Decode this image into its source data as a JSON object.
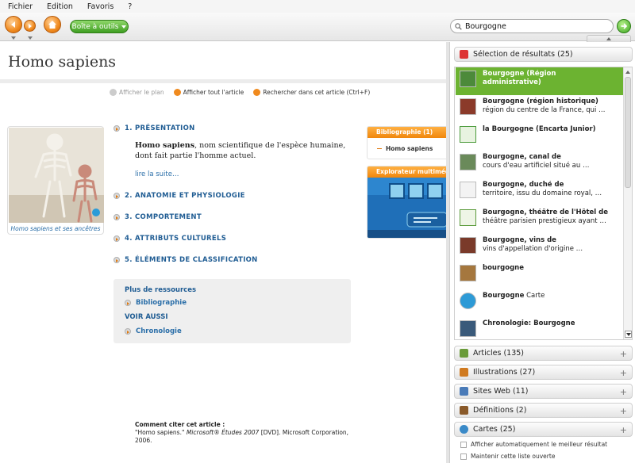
{
  "menu": [
    "Fichier",
    "Edition",
    "Favoris",
    "?"
  ],
  "toolbar": {
    "toolbox_label": "Boîte à outils",
    "search_value": "Bourgogne"
  },
  "article": {
    "title": "Homo sapiens",
    "tools": [
      "Afficher le plan",
      "Afficher tout l'article",
      "Rechercher dans cet article (Ctrl+F)"
    ],
    "image_caption": "Homo sapiens et ses ancêtres",
    "sections": [
      "1. PRÉSENTATION",
      "2. ANATOMIE ET PHYSIOLOGIE",
      "3. COMPORTEMENT",
      "4. ATTRIBUTS CULTURELS",
      "5. ÉLÉMENTS DE CLASSIFICATION"
    ],
    "intro_bold": "Homo sapiens",
    "intro_rest": ", nom scientifique de l'espèce humaine, dont fait partie l'homme actuel.",
    "read_more": "lire la suite…",
    "resources": {
      "title": "Plus de ressources",
      "biblio": "Bibliographie",
      "see_also": "VOIR AUSSI",
      "chrono": "Chronologie"
    },
    "citation": {
      "heading": "Comment citer cet article :",
      "text_a": "\"Homo sapiens.\" ",
      "text_b": "Microsoft® Études 2007",
      "text_c": " [DVD]. Microsoft Corporation, 2006."
    },
    "sidebar": {
      "biblio_title": "Bibliographie",
      "biblio_count": "(1)",
      "biblio_item": "Homo sapiens",
      "explorer_title": "Explorateur multimédia"
    }
  },
  "panel": {
    "results_title": "Sélection de résultats (25)",
    "results": [
      {
        "title": "Bourgogne (Région administrative)",
        "sub": "",
        "icon": "map-thumbnail"
      },
      {
        "title": "Bourgogne (région historique)",
        "sub": "région du centre de la France, qui …",
        "icon": "painting-thumbnail"
      },
      {
        "title": "la Bourgogne (Encarta Junior)",
        "sub": "",
        "icon": "junior-article-icon"
      },
      {
        "title": "Bourgogne, canal de",
        "sub": "cours d'eau artificiel situé au …",
        "icon": "canal-thumbnail"
      },
      {
        "title": "Bourgogne, duché de",
        "sub": "territoire, issu du domaine royal, …",
        "icon": "document-icon"
      },
      {
        "title": "Bourgogne, théâtre de l'Hôtel de",
        "sub": "théâtre parisien prestigieux ayant …",
        "icon": "article-icon"
      },
      {
        "title": "Bourgogne, vins de",
        "sub": "vins d'appellation d'origine …",
        "icon": "wine-thumbnail"
      },
      {
        "title": "bourgogne",
        "sub": "",
        "icon": "dictionary-icon"
      },
      {
        "title": "Bourgogne",
        "sub": "Carte",
        "icon": "globe-map-icon"
      },
      {
        "title": "Chronologie: Bourgogne",
        "sub": "",
        "icon": "timeline-icon"
      }
    ],
    "categories": [
      {
        "label": "Articles (135)",
        "color": "#6a9b3a"
      },
      {
        "label": "Illustrations (27)",
        "color": "#d07a20"
      },
      {
        "label": "Sites Web (11)",
        "color": "#4a7bb8"
      },
      {
        "label": "Définitions (2)",
        "color": "#8a5a2a"
      },
      {
        "label": "Cartes (25)",
        "color": "#3a8ac8"
      }
    ],
    "options": [
      "Afficher automatiquement le meilleur résultat",
      "Maintenir cette liste ouverte"
    ]
  },
  "colors": {
    "accent_orange": "#f08a1e",
    "selection_green": "#6cb331",
    "link_blue": "#1f5c93"
  }
}
